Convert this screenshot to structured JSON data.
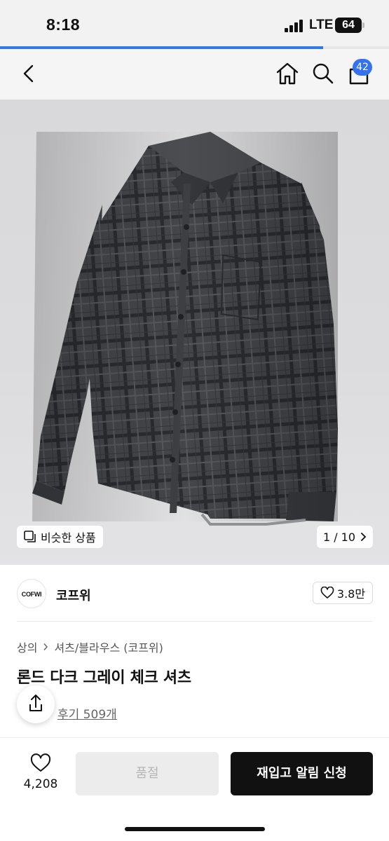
{
  "status_bar": {
    "time": "8:18",
    "network": "LTE",
    "battery": "64"
  },
  "page_load_progress": 0.83,
  "nav": {
    "icons": [
      "back-icon",
      "home-icon",
      "search-icon",
      "bag-icon"
    ],
    "cart_count": "42"
  },
  "gallery": {
    "similar_label": "비슷한 상품",
    "page_indicator": "1 / 10",
    "colors": {
      "shirt": "#3e4044",
      "check": "#25272b",
      "background": "#dcdcde"
    }
  },
  "shop": {
    "logo_text": "COFWI",
    "name": "코프위",
    "likes": "3.8만"
  },
  "product": {
    "breadcrumb": [
      "상의",
      "셔츠/블라우스 (코프위)"
    ],
    "title": "론드 다크 그레이 체크 셔츠",
    "reviews": "후기 509개"
  },
  "bottom_bar": {
    "wish_count": "4,208",
    "soldout_label": "품절",
    "restock_label": "재입고 알림 신청"
  }
}
